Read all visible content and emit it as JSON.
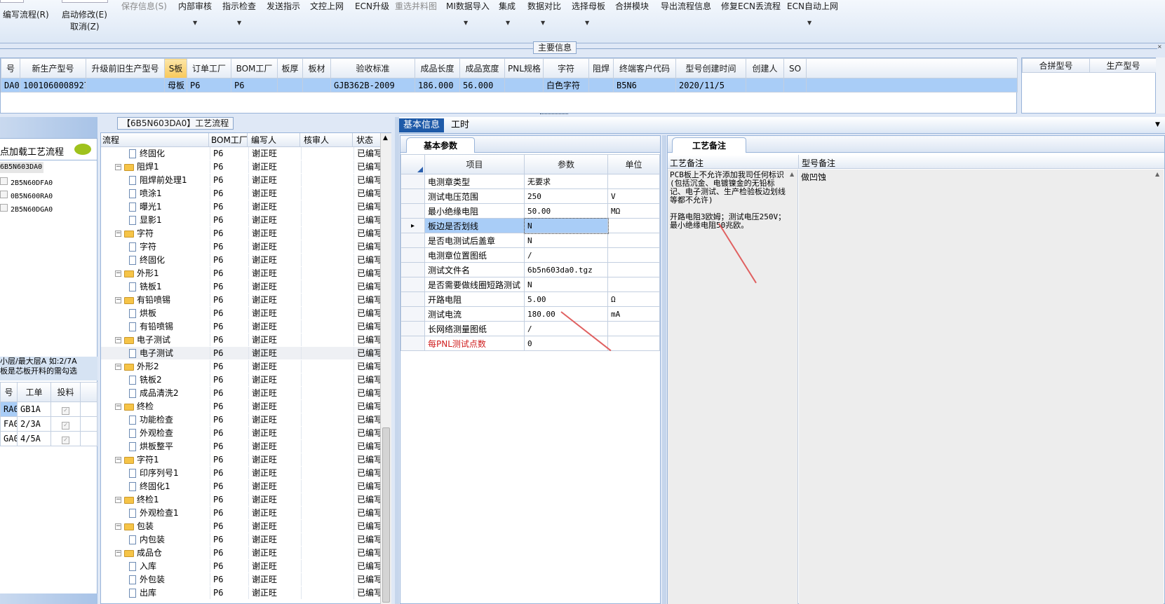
{
  "toolbar": {
    "row1": [
      "保存信息(S)",
      "内部审核",
      "指示检查",
      "发送指示",
      "文控上网",
      "ECN升级",
      "重选并料图",
      "MI数据导入",
      "集成",
      "数据对比",
      "选择母板",
      "合拼模块",
      "导出流程信息",
      "修复ECN丢流程",
      "ECN自动上网"
    ],
    "write_flow": "编写流程(R)",
    "start_modify": "启动修改(E)",
    "cancel": "取消(Z)"
  },
  "main_info": {
    "caption": "主要信息",
    "columns": [
      "号",
      "新生产型号",
      "升级前旧生产型号",
      "S板",
      "订单工厂",
      "BOM工厂",
      "板厚",
      "板材",
      "验收标准",
      "成品长度",
      "成品宽度",
      "PNL规格",
      "字符",
      "阻焊",
      "终端客户代码",
      "型号创建时间",
      "创建人",
      "SO"
    ],
    "row": [
      "DA0",
      "10010600089276",
      "",
      "母板",
      "P6",
      "P6",
      "",
      "",
      "GJB362B-2009",
      "186.000",
      "56.000",
      "",
      "白色字符",
      "",
      "B5N6",
      "2020/11/5",
      "",
      ""
    ],
    "right_columns": [
      "合拼型号",
      "生产型号"
    ]
  },
  "left_panel": {
    "load_flow": "点加载工艺流程",
    "tree_items": [
      "6B5N603DA0",
      "2B5N60DFA0",
      "0B5N600RA0",
      "2B5N60DGA0"
    ],
    "hint_line1": "小层/最大层A 如:2/7A",
    "hint_line2": "板是芯板开料的需勾选",
    "grid_columns": [
      "号",
      "工单",
      "投料"
    ],
    "grid_rows": [
      {
        "id": "RA0",
        "order": "GB1A"
      },
      {
        "id": "FA0",
        "order": "2/3A"
      },
      {
        "id": "GA0",
        "order": "4/5A"
      }
    ]
  },
  "flow_panel": {
    "caption": "【6B5N603DA0】工艺流程",
    "columns": [
      "流程",
      "BOM工厂",
      "编写人",
      "核审人",
      "状态"
    ],
    "rows": [
      {
        "name": "终固化",
        "level": 2,
        "factory": "P6",
        "writer": "谢正旺",
        "status": "已编写"
      },
      {
        "name": "阻焊1",
        "level": 1,
        "factory": "P6",
        "writer": "谢正旺",
        "status": "已编写"
      },
      {
        "name": "阻焊前处理1",
        "level": 2,
        "factory": "P6",
        "writer": "谢正旺",
        "status": "已编写"
      },
      {
        "name": "喷涂1",
        "level": 2,
        "factory": "P6",
        "writer": "谢正旺",
        "status": "已编写"
      },
      {
        "name": "曝光1",
        "level": 2,
        "factory": "P6",
        "writer": "谢正旺",
        "status": "已编写"
      },
      {
        "name": "显影1",
        "level": 2,
        "factory": "P6",
        "writer": "谢正旺",
        "status": "已编写"
      },
      {
        "name": "字符",
        "level": 1,
        "factory": "P6",
        "writer": "谢正旺",
        "status": "已编写"
      },
      {
        "name": "字符",
        "level": 2,
        "factory": "P6",
        "writer": "谢正旺",
        "status": "已编写"
      },
      {
        "name": "终固化",
        "level": 2,
        "factory": "P6",
        "writer": "谢正旺",
        "status": "已编写"
      },
      {
        "name": "外形1",
        "level": 1,
        "factory": "P6",
        "writer": "谢正旺",
        "status": "已编写"
      },
      {
        "name": "铣板1",
        "level": 2,
        "factory": "P6",
        "writer": "谢正旺",
        "status": "已编写"
      },
      {
        "name": "有铅喷锡",
        "level": 1,
        "factory": "P6",
        "writer": "谢正旺",
        "status": "已编写"
      },
      {
        "name": "烘板",
        "level": 2,
        "factory": "P6",
        "writer": "谢正旺",
        "status": "已编写"
      },
      {
        "name": "有铅喷锡",
        "level": 2,
        "factory": "P6",
        "writer": "谢正旺",
        "status": "已编写"
      },
      {
        "name": "电子测试",
        "level": 1,
        "factory": "P6",
        "writer": "谢正旺",
        "status": "已编写"
      },
      {
        "name": "电子测试",
        "level": 2,
        "factory": "P6",
        "writer": "谢正旺",
        "status": "已编写"
      },
      {
        "name": "外形2",
        "level": 1,
        "factory": "P6",
        "writer": "谢正旺",
        "status": "已编写"
      },
      {
        "name": "铣板2",
        "level": 2,
        "factory": "P6",
        "writer": "谢正旺",
        "status": "已编写"
      },
      {
        "name": "成品清洗2",
        "level": 2,
        "factory": "P6",
        "writer": "谢正旺",
        "status": "已编写"
      },
      {
        "name": "终检",
        "level": 1,
        "factory": "P6",
        "writer": "谢正旺",
        "status": "已编写"
      },
      {
        "name": "功能检查",
        "level": 2,
        "factory": "P6",
        "writer": "谢正旺",
        "status": "已编写"
      },
      {
        "name": "外观检查",
        "level": 2,
        "factory": "P6",
        "writer": "谢正旺",
        "status": "已编写"
      },
      {
        "name": "烘板整平",
        "level": 2,
        "factory": "P6",
        "writer": "谢正旺",
        "status": "已编写"
      },
      {
        "name": "字符1",
        "level": 1,
        "factory": "P6",
        "writer": "谢正旺",
        "status": "已编写"
      },
      {
        "name": "印序列号1",
        "level": 2,
        "factory": "P6",
        "writer": "谢正旺",
        "status": "已编写"
      },
      {
        "name": "终固化1",
        "level": 2,
        "factory": "P6",
        "writer": "谢正旺",
        "status": "已编写"
      },
      {
        "name": "终检1",
        "level": 1,
        "factory": "P6",
        "writer": "谢正旺",
        "status": "已编写"
      },
      {
        "name": "外观检查1",
        "level": 2,
        "factory": "P6",
        "writer": "谢正旺",
        "status": "已编写"
      },
      {
        "name": "包装",
        "level": 1,
        "factory": "P6",
        "writer": "谢正旺",
        "status": "已编写"
      },
      {
        "name": "内包装",
        "level": 2,
        "factory": "P6",
        "writer": "谢正旺",
        "status": "已编写"
      },
      {
        "name": "成品仓",
        "level": 1,
        "factory": "P6",
        "writer": "谢正旺",
        "status": "已编写"
      },
      {
        "name": "入库",
        "level": 2,
        "factory": "P6",
        "writer": "谢正旺",
        "status": "已编写"
      },
      {
        "name": "外包装",
        "level": 2,
        "factory": "P6",
        "writer": "谢正旺",
        "status": "已编写"
      },
      {
        "name": "出库",
        "level": 2,
        "factory": "P6",
        "writer": "谢正旺",
        "status": "已编写"
      }
    ]
  },
  "basic_info": {
    "tabs": [
      "基本信息",
      "工时"
    ],
    "subtab": "基本参数",
    "columns": [
      "项目",
      "参数",
      "单位"
    ],
    "rows": [
      {
        "item": "电测章类型",
        "param": "无要求",
        "unit": ""
      },
      {
        "item": "测试电压范围",
        "param": "250",
        "unit": "V"
      },
      {
        "item": "最小绝缘电阻",
        "param": "50.00",
        "unit": "MΩ"
      },
      {
        "item": "板边是否划线",
        "param": "N",
        "unit": ""
      },
      {
        "item": "是否电测试后盖章",
        "param": "N",
        "unit": ""
      },
      {
        "item": "电测章位置图纸",
        "param": "/",
        "unit": ""
      },
      {
        "item": "测试文件名",
        "param": "6b5n603da0.tgz",
        "unit": ""
      },
      {
        "item": "是否需要做线圈短路测试",
        "param": "N",
        "unit": ""
      },
      {
        "item": "开路电阻",
        "param": "5.00",
        "unit": "Ω"
      },
      {
        "item": "测试电流",
        "param": "180.00",
        "unit": "mA"
      },
      {
        "item": "长网络测量图纸",
        "param": "/",
        "unit": ""
      },
      {
        "item": "每PNL测试点数",
        "param": "0",
        "unit": ""
      }
    ]
  },
  "remarks": {
    "tab": "工艺备注",
    "col1": "工艺备注",
    "col2": "型号备注",
    "process_note": "PCB板上不允许添加我司任何标识(包括沉金、电镀镍金的无铅标记、电子测试、生产检验板边划线等都不允许)\n\n开路电阻3欧姆；测试电压250V；最小绝缘电阻50兆欧。",
    "model_note": "做凹蚀"
  }
}
